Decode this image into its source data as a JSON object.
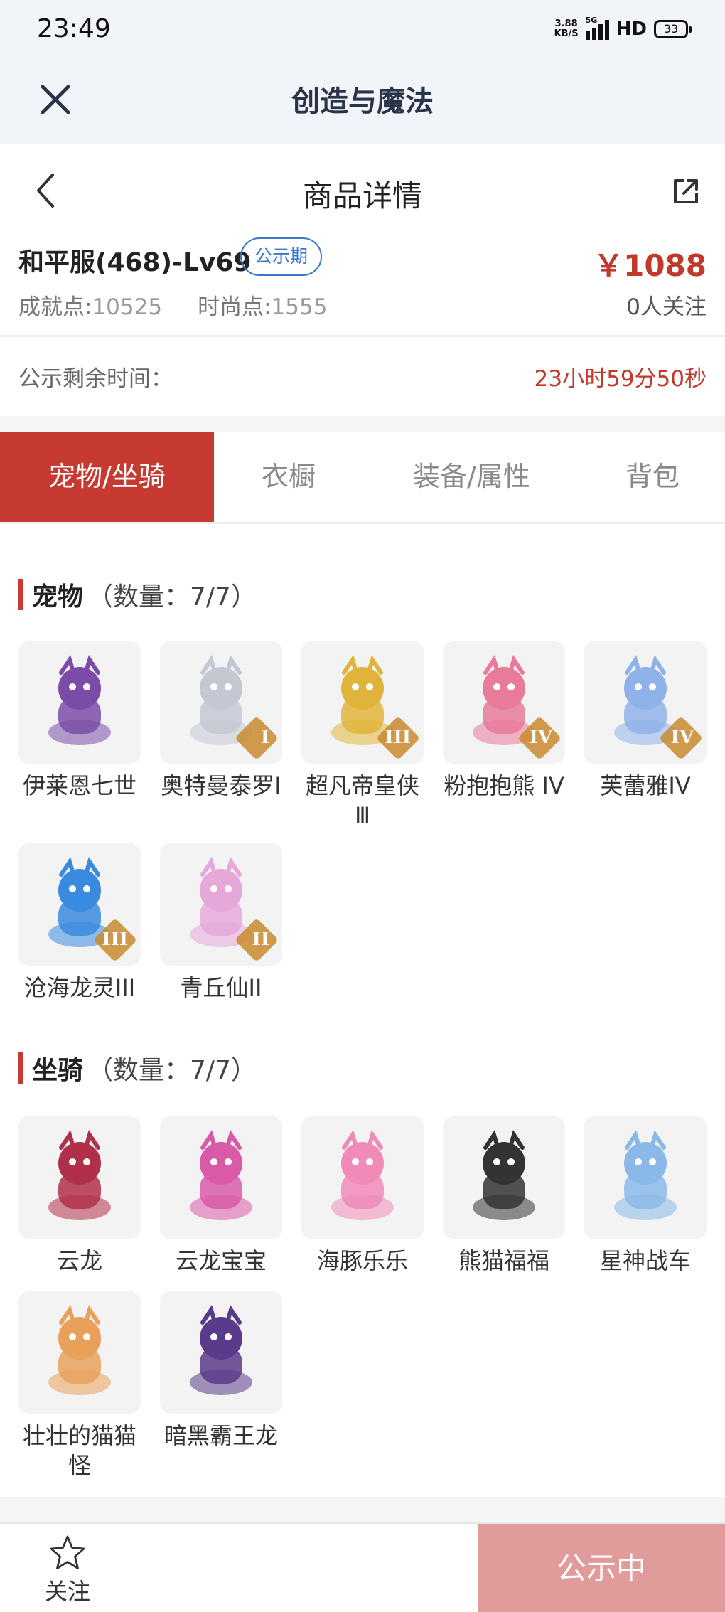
{
  "status": {
    "time": "23:49",
    "net_speed_value": "3.88",
    "net_speed_unit": "KB/S",
    "network": "5G",
    "hd": "HD",
    "battery": "33"
  },
  "app": {
    "title": "创造与魔法"
  },
  "nav": {
    "title": "商品详情"
  },
  "product": {
    "name": "和平服(468)-Lv69",
    "badge": "公示期",
    "price": "￥1088",
    "achievement_label": "成就点:",
    "achievement_value": "10525",
    "fashion_label": "时尚点:",
    "fashion_value": "1555",
    "followers": "0人关注"
  },
  "timer": {
    "label": "公示剩余时间：",
    "value": "23小时59分50秒"
  },
  "tabs": [
    {
      "label": "宠物/坐骑",
      "active": true
    },
    {
      "label": "衣橱",
      "active": false
    },
    {
      "label": "装备/属性",
      "active": false
    },
    {
      "label": "背包",
      "active": false
    }
  ],
  "pets": {
    "title": "宠物",
    "count": "（数量：7/7）",
    "items": [
      {
        "name": "伊莱恩七世",
        "icon": "armored-warrior-pet",
        "color": "#7a4ca8"
      },
      {
        "name": "奥特曼泰罗Ⅰ",
        "icon": "ultraman-pet",
        "color": "#c4c8d2",
        "rank": "I"
      },
      {
        "name": "超凡帝皇侠Ⅲ",
        "icon": "golden-armor-pet",
        "color": "#e0b43a",
        "rank": "III"
      },
      {
        "name": "粉抱抱熊 IV",
        "icon": "pink-bear-pet",
        "color": "#e87a9a",
        "rank": "IV"
      },
      {
        "name": "芙蕾雅IV",
        "icon": "valkyrie-pet",
        "color": "#8fb2e8",
        "rank": "IV"
      },
      {
        "name": "沧海龙灵III",
        "icon": "dragon-spirit-pet",
        "color": "#3a8ae0",
        "rank": "III"
      },
      {
        "name": "青丘仙II",
        "icon": "fox-fairy-pet",
        "color": "#e6a8d8",
        "rank": "II"
      }
    ]
  },
  "mounts": {
    "title": "坐骑",
    "count": "（数量：7/7）",
    "items": [
      {
        "name": "云龙",
        "icon": "cloud-dragon-mount",
        "color": "#b0304a"
      },
      {
        "name": "云龙宝宝",
        "icon": "baby-dragon-mount",
        "color": "#d85aa8"
      },
      {
        "name": "海豚乐乐",
        "icon": "dolphin-mount",
        "color": "#f08ab8"
      },
      {
        "name": "熊猫福福",
        "icon": "panda-mount",
        "color": "#333333"
      },
      {
        "name": "星神战车",
        "icon": "star-chariot-mount",
        "color": "#8ab8e8"
      },
      {
        "name": "壮壮的猫猫怪",
        "icon": "cat-monster-mount",
        "color": "#e8a05a"
      },
      {
        "name": "暗黑霸王龙",
        "icon": "dark-trex-mount",
        "color": "#5a3a8a"
      }
    ]
  },
  "footer": {
    "follow_label": "关注",
    "cta": "公示中"
  }
}
